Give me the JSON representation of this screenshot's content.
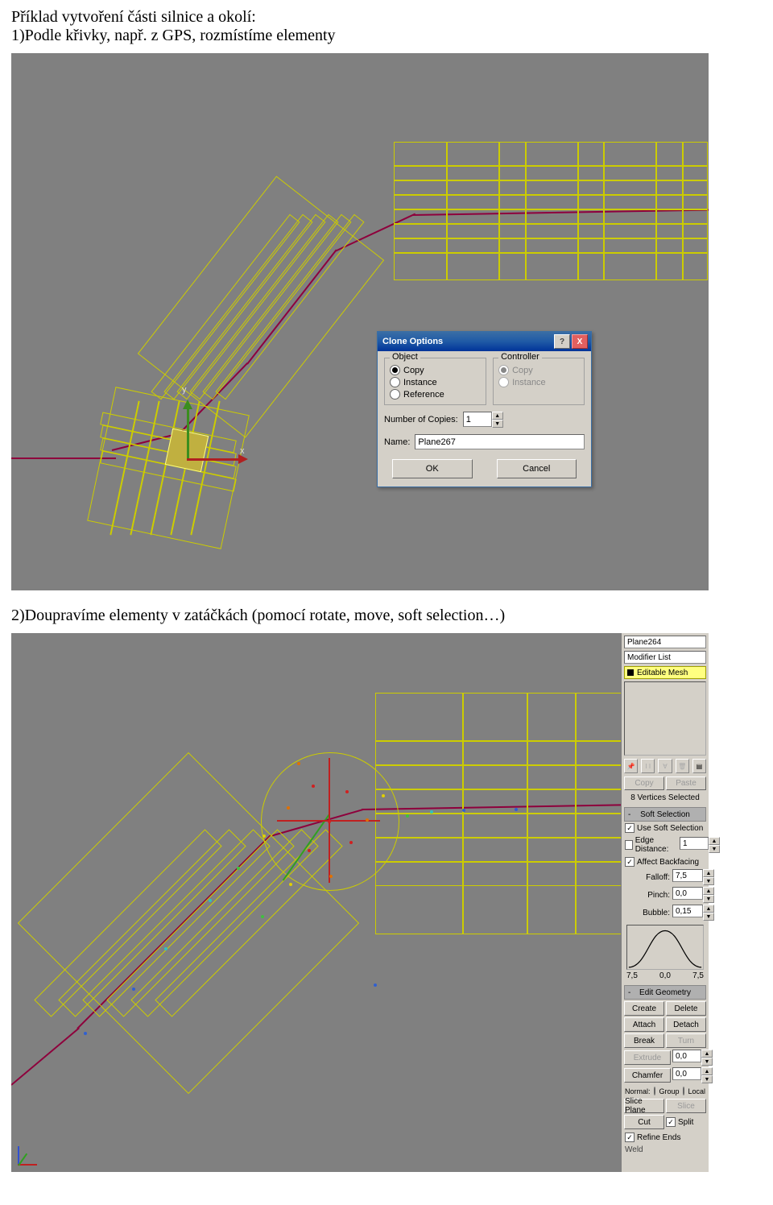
{
  "doc": {
    "line1": "Příklad vytvoření části silnice a okolí:",
    "line2": "1)Podle křivky, např. z GPS, rozmístíme elementy",
    "line3": "2)Doupravíme elementy v zatáčkách (pomocí rotate, move, soft selection…)"
  },
  "dialog": {
    "title": "Clone Options",
    "grp_object": "Object",
    "grp_controller": "Controller",
    "obj_copy": "Copy",
    "obj_instance": "Instance",
    "obj_reference": "Reference",
    "ctrl_copy": "Copy",
    "ctrl_instance": "Instance",
    "numcopies_lbl": "Number of Copies:",
    "numcopies_val": "1",
    "name_lbl": "Name:",
    "name_val": "Plane267",
    "ok": "OK",
    "cancel": "Cancel",
    "help": "?",
    "close": "X"
  },
  "panel": {
    "objname": "Plane264",
    "modlist": "Modifier List",
    "stackitem": "Editable Mesh",
    "copy": "Copy",
    "paste": "Paste",
    "selinfo": "8 Vertices Selected",
    "soft_title": "Soft Selection",
    "use_soft": "Use Soft Selection",
    "edge_dist": "Edge Distance:",
    "edge_dist_val": "1",
    "affect_bf": "Affect Backfacing",
    "falloff_lbl": "Falloff:",
    "falloff_val": "7,5",
    "pinch_lbl": "Pinch:",
    "pinch_val": "0,0",
    "bubble_lbl": "Bubble:",
    "bubble_val": "0,15",
    "curve_l": "7,5",
    "curve_c": "0,0",
    "curve_r": "7,5",
    "edit_title": "Edit Geometry",
    "create": "Create",
    "delete": "Delete",
    "attach": "Attach",
    "detach": "Detach",
    "break": "Break",
    "turn": "Turn",
    "extrude": "Extrude",
    "extrude_v": "0,0",
    "chamfer": "Chamfer",
    "chamfer_v": "0,0",
    "normal": "Normal:",
    "group": "Group",
    "local": "Local",
    "sliceplane": "Slice Plane",
    "slice": "Slice",
    "cut": "Cut",
    "split": "Split",
    "refine": "Refine Ends",
    "weld": "Weld"
  }
}
